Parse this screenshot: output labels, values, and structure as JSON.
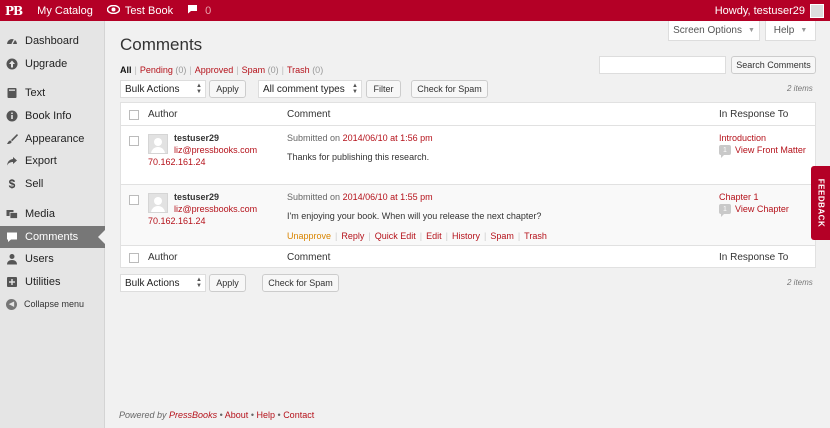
{
  "adminbar": {
    "logo": "PB",
    "my_catalog": "My Catalog",
    "test_book": "Test Book",
    "comments_count": "0",
    "howdy": "Howdy, testuser29"
  },
  "sidebar": {
    "items": [
      {
        "label": "Dashboard",
        "icon": "dashboard-icon"
      },
      {
        "label": "Upgrade",
        "icon": "upgrade-icon"
      },
      {
        "label": "Text",
        "icon": "text-icon"
      },
      {
        "label": "Book Info",
        "icon": "info-icon"
      },
      {
        "label": "Appearance",
        "icon": "paintbrush-icon"
      },
      {
        "label": "Export",
        "icon": "export-icon"
      },
      {
        "label": "Sell",
        "icon": "dollar-icon"
      },
      {
        "label": "Media",
        "icon": "media-icon"
      },
      {
        "label": "Comments",
        "icon": "comment-icon"
      },
      {
        "label": "Users",
        "icon": "users-icon"
      },
      {
        "label": "Utilities",
        "icon": "utilities-icon"
      }
    ],
    "collapse": "Collapse menu"
  },
  "top_tabs": {
    "screen_options": "Screen Options",
    "help": "Help"
  },
  "page": {
    "title": "Comments"
  },
  "filters": {
    "all": "All",
    "pending": "Pending",
    "pending_count": "(0)",
    "approved": "Approved",
    "spam": "Spam",
    "spam_count": "(0)",
    "trash": "Trash",
    "trash_count": "(0)"
  },
  "search": {
    "value": "",
    "button": "Search Comments"
  },
  "top_actions": {
    "bulk": "Bulk Actions",
    "apply": "Apply",
    "types": "All comment types",
    "filter": "Filter",
    "check_spam": "Check for Spam",
    "items": "2 items"
  },
  "bottom_actions": {
    "bulk": "Bulk Actions",
    "apply": "Apply",
    "check_spam": "Check for Spam",
    "items": "2 items"
  },
  "table": {
    "columns": {
      "author": "Author",
      "comment": "Comment",
      "response": "In Response To"
    },
    "rows": [
      {
        "author": "testuser29",
        "email": "liz@pressbooks.com",
        "ip": "70.162.161.24",
        "submitted_label": "Submitted on",
        "date": "2014/06/10 at 1:56 pm",
        "text": "Thanks for publishing this research.",
        "response_title": "Introduction",
        "response_count": "1",
        "response_view": "View Front Matter"
      },
      {
        "author": "testuser29",
        "email": "liz@pressbooks.com",
        "ip": "70.162.161.24",
        "submitted_label": "Submitted on",
        "date": "2014/06/10 at 1:55 pm",
        "text": "I'm enjoying your book. When will you release the next chapter?",
        "response_title": "Chapter 1",
        "response_count": "1",
        "response_view": "View Chapter",
        "actions": [
          "Unapprove",
          "Reply",
          "Quick Edit",
          "Edit",
          "History",
          "Spam",
          "Trash"
        ]
      }
    ]
  },
  "feedback": "FEEDBACK",
  "footer": {
    "powered": "Powered by",
    "brand": "PressBooks",
    "about": "About",
    "help": "Help",
    "contact": "Contact"
  },
  "colors": {
    "accent": "#b40026",
    "link": "#b5121b",
    "unapprove": "#d98500"
  }
}
